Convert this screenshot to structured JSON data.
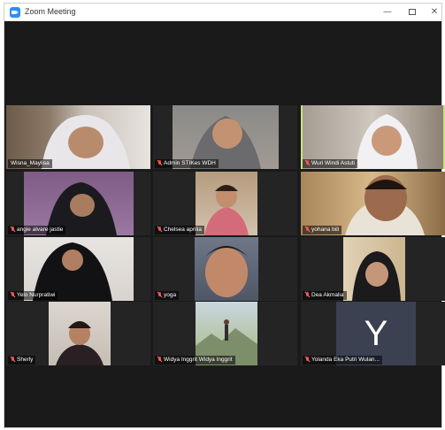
{
  "window": {
    "title": "Zoom Meeting"
  },
  "window_controls": {
    "minimize": "—",
    "close": "✕"
  },
  "participants": [
    {
      "name": "Wisna_Maylisa",
      "muted": false
    },
    {
      "name": "Admin STIKes WDH",
      "muted": true
    },
    {
      "name": "Wuri Windi Astuti",
      "muted": true
    },
    {
      "name": "angie alvare jastie",
      "muted": true
    },
    {
      "name": "Chelsea aprilia",
      "muted": true
    },
    {
      "name": "yohana bili",
      "muted": false
    },
    {
      "name": "Yelo Nurpratiwi",
      "muted": true
    },
    {
      "name": "yoga",
      "muted": true
    },
    {
      "name": "Dea Akmalia",
      "muted": true
    },
    {
      "name": "Sherly",
      "muted": true
    },
    {
      "name": "Widya Inggrit Widya Inggrit",
      "muted": true
    },
    {
      "name": "Yolanda Eka Putri Wulan...",
      "muted": true,
      "avatar_letter": "Y"
    }
  ],
  "colors": {
    "background": "#1a1a1a",
    "tile": "#242424",
    "active_speaker_border": "#c7e47a",
    "mic_off": "#e5483f",
    "zoom_blue": "#2d8cff"
  }
}
